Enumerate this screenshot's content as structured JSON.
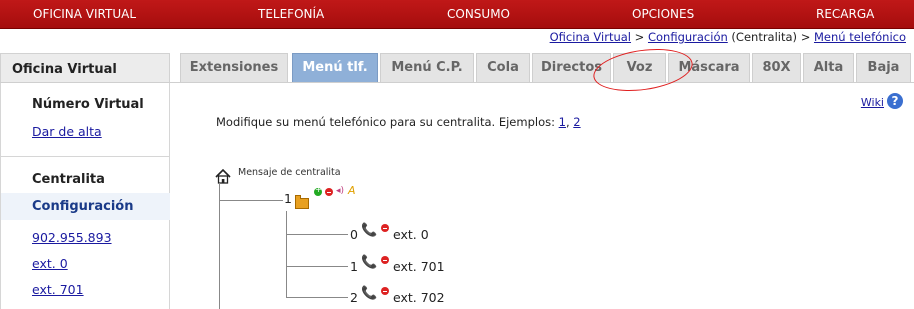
{
  "topnav": [
    "OFICINA VIRTUAL",
    "TELEFONÍA",
    "CONSUMO",
    "OPCIONES",
    "RECARGA"
  ],
  "breadcrumb": {
    "item1": "Oficina Virtual",
    "sep1": " > ",
    "item2": "Configuración",
    "plain": " (Centralita) > ",
    "item3": "Menú telefónico"
  },
  "sidebar": {
    "header": "Oficina Virtual",
    "section1_title": "Número Virtual",
    "section1_link": "Dar de alta",
    "section2_title": "Centralita",
    "active_item": "Configuración",
    "links": [
      "902.955.893",
      "ext. 0",
      "ext. 701"
    ]
  },
  "tabs": [
    "Extensiones",
    "Menú tlf.",
    "Menú C.P.",
    "Cola",
    "Directos",
    "Voz",
    "Máscara",
    "80X",
    "Alta",
    "Baja"
  ],
  "active_tab": "Menú tlf.",
  "main": {
    "wiki": "Wiki",
    "intro_text": "Modifique su menú telefónico para su centralita. Ejemplos: ",
    "example1": "1",
    "example_sep": ", ",
    "example2": "2",
    "tree_root_label": "Mensaje de centralita",
    "node_root_number": "1",
    "children": [
      {
        "number": "0",
        "ext": "ext. 0"
      },
      {
        "number": "1",
        "ext": "ext. 701"
      },
      {
        "number": "2",
        "ext": "ext. 702"
      }
    ]
  },
  "colors": {
    "nav_red": "#b01010",
    "active_tab": "#8fb0d8",
    "link": "#1a1aa0",
    "annotation": "#e02020"
  }
}
